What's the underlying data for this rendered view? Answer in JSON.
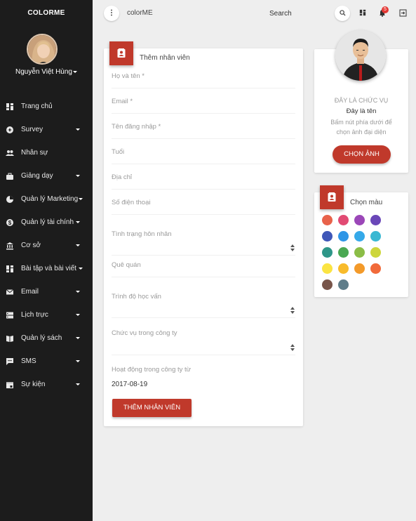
{
  "sidebar": {
    "brand": "COLORME",
    "user_name": "Nguyễn Việt Hùng",
    "items": [
      {
        "label": "Trang chủ",
        "icon": "dashboard-icon",
        "has_caret": false
      },
      {
        "label": "Survey",
        "icon": "survey-icon",
        "has_caret": true
      },
      {
        "label": "Nhân sự",
        "icon": "people-icon",
        "has_caret": false
      },
      {
        "label": "Giảng dạy",
        "icon": "briefcase-icon",
        "has_caret": true
      },
      {
        "label": "Quản lý Marketing",
        "icon": "pie-chart-icon",
        "has_caret": true
      },
      {
        "label": "Quản lý tài chính",
        "icon": "dollar-icon",
        "has_caret": true
      },
      {
        "label": "Cơ sở",
        "icon": "bank-icon",
        "has_caret": true
      },
      {
        "label": "Bài tập và bài viết",
        "icon": "dashboard-icon",
        "has_caret": true
      },
      {
        "label": "Email",
        "icon": "email-icon",
        "has_caret": true
      },
      {
        "label": "Lịch trực",
        "icon": "storage-icon",
        "has_caret": true
      },
      {
        "label": "Quản lý sách",
        "icon": "book-icon",
        "has_caret": true
      },
      {
        "label": "SMS",
        "icon": "sms-icon",
        "has_caret": true
      },
      {
        "label": "Sự kiện",
        "icon": "event-icon",
        "has_caret": true
      }
    ]
  },
  "topbar": {
    "title": "colorME",
    "search_label": "Search",
    "notification_count": "5"
  },
  "form": {
    "title": "Thêm nhân viên",
    "fields": [
      {
        "label": "Họ và tên *",
        "type": "text"
      },
      {
        "label": "Email *",
        "type": "text"
      },
      {
        "label": "Tên đăng nhập *",
        "type": "text"
      },
      {
        "label": "Tuổi",
        "type": "text"
      },
      {
        "label": "Địa chỉ",
        "type": "text"
      },
      {
        "label": "Số điện thoại",
        "type": "text"
      },
      {
        "label": "Tình trạng hôn nhân",
        "type": "select"
      },
      {
        "label": "Quê quán",
        "type": "text"
      },
      {
        "label": "Trình độ học vấn",
        "type": "select"
      },
      {
        "label": "Chức vụ trong công ty",
        "type": "select"
      },
      {
        "label": "Hoạt động trong công ty từ",
        "type": "date"
      }
    ],
    "start_date": "2017-08-19",
    "submit_label": "THÊM NHÂN VIÊN"
  },
  "profile": {
    "role": "ĐÂY LÀ CHỨC VỤ",
    "name": "Đây là tên",
    "hint": "Bấm nút phía dưới để chọn ảnh đại diện",
    "button_label": "CHỌN ẢNH"
  },
  "colors": {
    "title": "Chọn màu",
    "swatches": [
      "#e8624a",
      "#e14a73",
      "#9b47b8",
      "#6a47b8",
      "#3f57b8",
      "#2f96e6",
      "#35a9e9",
      "#3ab8d2",
      "#2e9688",
      "#4aa852",
      "#8bbd47",
      "#cdd63b",
      "#fbe442",
      "#f8bb2b",
      "#f39a2a",
      "#f16a3a",
      "#78554a",
      "#5f7d8a"
    ]
  },
  "theme": {
    "accent": "#c0392b",
    "sidebar_bg": "#1c1c1c",
    "page_bg": "#eeeeee"
  }
}
